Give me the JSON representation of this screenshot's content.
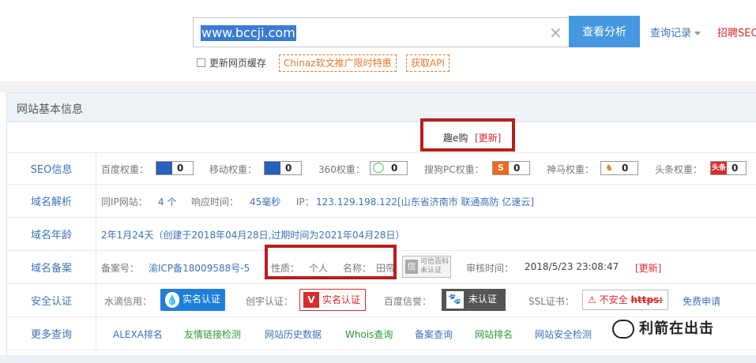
{
  "header": {
    "url_value": "www.bccji.com",
    "clear_icon": "×",
    "search_button": "查看分析",
    "history_link": "查询记录",
    "hire_link": "招聘SEO",
    "cache_label": "更新网页缓存",
    "promo_1": "Chinaz软文推广限时特惠",
    "promo_2": "获取API"
  },
  "panel": {
    "title": "网站基本信息",
    "site_name_text": "趣e购",
    "update_link": "[更新]"
  },
  "seo": {
    "label": "SEO信息",
    "items": [
      {
        "name": "百度权重：",
        "value": "0",
        "icon": "paw-icon",
        "color": "#2b5fb8"
      },
      {
        "name": "移动权重：",
        "value": "0",
        "icon": "paw-icon",
        "color": "#2b5fb8"
      },
      {
        "name": "360权重：",
        "value": "0",
        "icon": "360-icon",
        "color": "#3aa93a"
      },
      {
        "name": "搜狗PC权重：",
        "value": "0",
        "icon": "sogou-icon",
        "color": "#f06a1d"
      },
      {
        "name": "神马权重：",
        "value": "0",
        "icon": "shenma-icon",
        "color": "#d08a27"
      },
      {
        "name": "头条权重：",
        "value": "0",
        "icon": "toutiao-icon",
        "color": "#d82b2b"
      }
    ]
  },
  "dns": {
    "label": "域名解析",
    "same_ip_label": "同IP网站：",
    "same_ip_value": "4 个",
    "response_label": "响应时间：",
    "response_value": "45毫秒",
    "ip_label": "IP：",
    "ip_value": "123.129.198.122[山东省济南市 联通高防 亿速云]"
  },
  "age": {
    "label": "域名年龄",
    "value": "2年1月24天（创建于2018年04月28日,过期时间为2021年04月28日）"
  },
  "icp": {
    "label": "域名备案",
    "no_label": "备案号：",
    "no_value": "渝ICP备18009588号-5",
    "type_label": "性质：",
    "type_value": "个人",
    "name_label": "名称：",
    "name_value": "田帝",
    "trust_badge_1": "可信百科",
    "trust_badge_2": "未认证",
    "audit_label": "审核时间：",
    "audit_value": "2018/5/23 23:08:47",
    "update_link": "[更新]"
  },
  "security": {
    "label": "安全认证",
    "shuidi_label": "水滴信用：",
    "shuidi_badge": "实名认证",
    "chuangyu_label": "创宇认证：",
    "chuangyu_badge": "实名认证",
    "baidu_label": "百度信誉：",
    "baidu_badge": "未认证",
    "ssl_label": "SSL证书：",
    "ssl_badge": "不安全",
    "ssl_badge_https": "https:",
    "free_apply": "免费申请"
  },
  "more": {
    "label": "更多查询",
    "links": [
      "ALEXA排名",
      "友情链接检测",
      "网站历史数据",
      "Whois查询",
      "备案查询",
      "网站排名",
      "网站安全检测"
    ]
  },
  "watermark": "利箭在出击"
}
